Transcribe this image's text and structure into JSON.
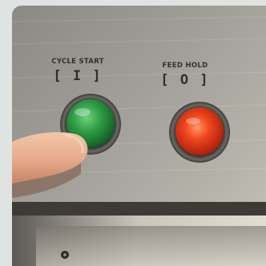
{
  "photo": {
    "left_button": {
      "label": "CYCLE START",
      "symbol": "[ I ]",
      "color": "#2f9e45"
    },
    "right_button": {
      "label": "FEED HOLD",
      "symbol": "[ O ]",
      "color": "#f0471e"
    },
    "panel_color": "#9a9891",
    "frame_color": "#dfe3e2"
  }
}
